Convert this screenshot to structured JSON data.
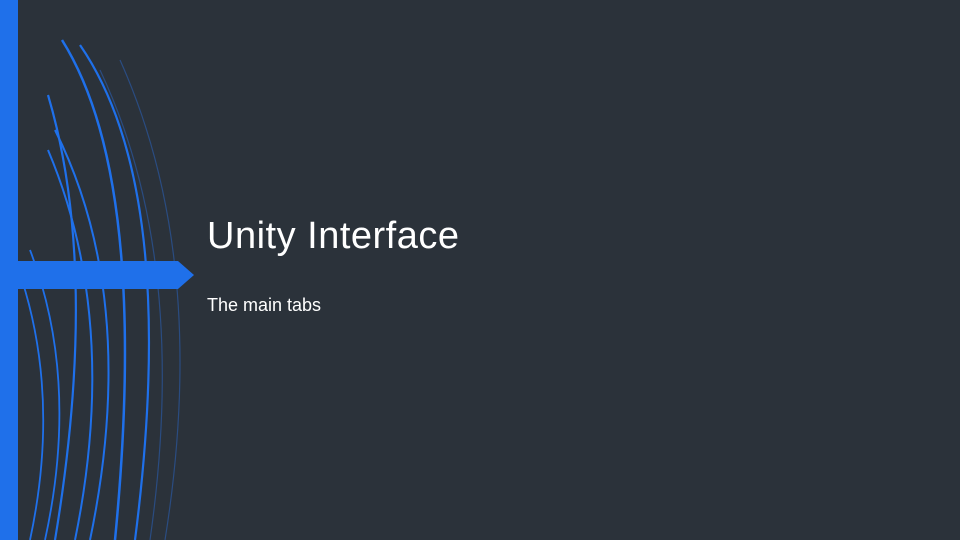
{
  "slide": {
    "title": "Unity Interface",
    "subtitle": "The main tabs"
  },
  "theme": {
    "background": "#2b323a",
    "accent": "#1f70ea",
    "text": "#ffffff"
  }
}
